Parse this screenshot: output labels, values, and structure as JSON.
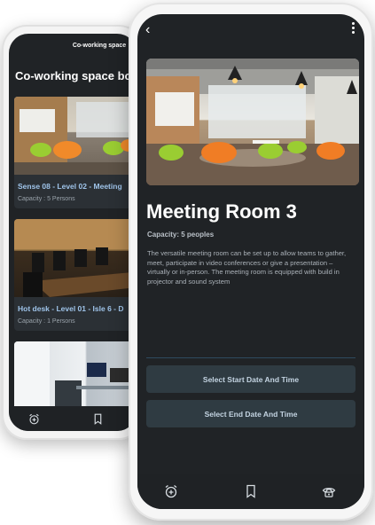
{
  "back_screen": {
    "header_title": "Co-working space",
    "heading": "Co-working space boo",
    "cards": [
      {
        "title": "Sense 08 - Level 02 - Meeting",
        "capacity": "Capacity : 5 Persons"
      },
      {
        "title": "Hot desk - Level 01 - Isle 6 - D",
        "capacity": "Capacity : 1 Persons"
      },
      {
        "title": "",
        "capacity": ""
      }
    ],
    "nav_icons": [
      "alarm-add-icon",
      "bookmark-icon"
    ]
  },
  "front_screen": {
    "room_title": "Meeting Room 3",
    "capacity_text": "Capacity: 5 peoples",
    "description": "The versatile meeting room can be set up to allow teams to gather, meet, participate in video conferences or give a presentation – virtually or in-person. The meeting room is equipped with build in projector and sound system",
    "start_button": "Select Start Date And Time",
    "end_button": "Select End Date And Time",
    "nav_icons": [
      "alarm-add-icon",
      "bookmark-icon",
      "phone-icon"
    ]
  },
  "colors": {
    "screen_bg": "#202326",
    "button_bg": "#2f3b42",
    "card_title": "#9fc4ea"
  }
}
